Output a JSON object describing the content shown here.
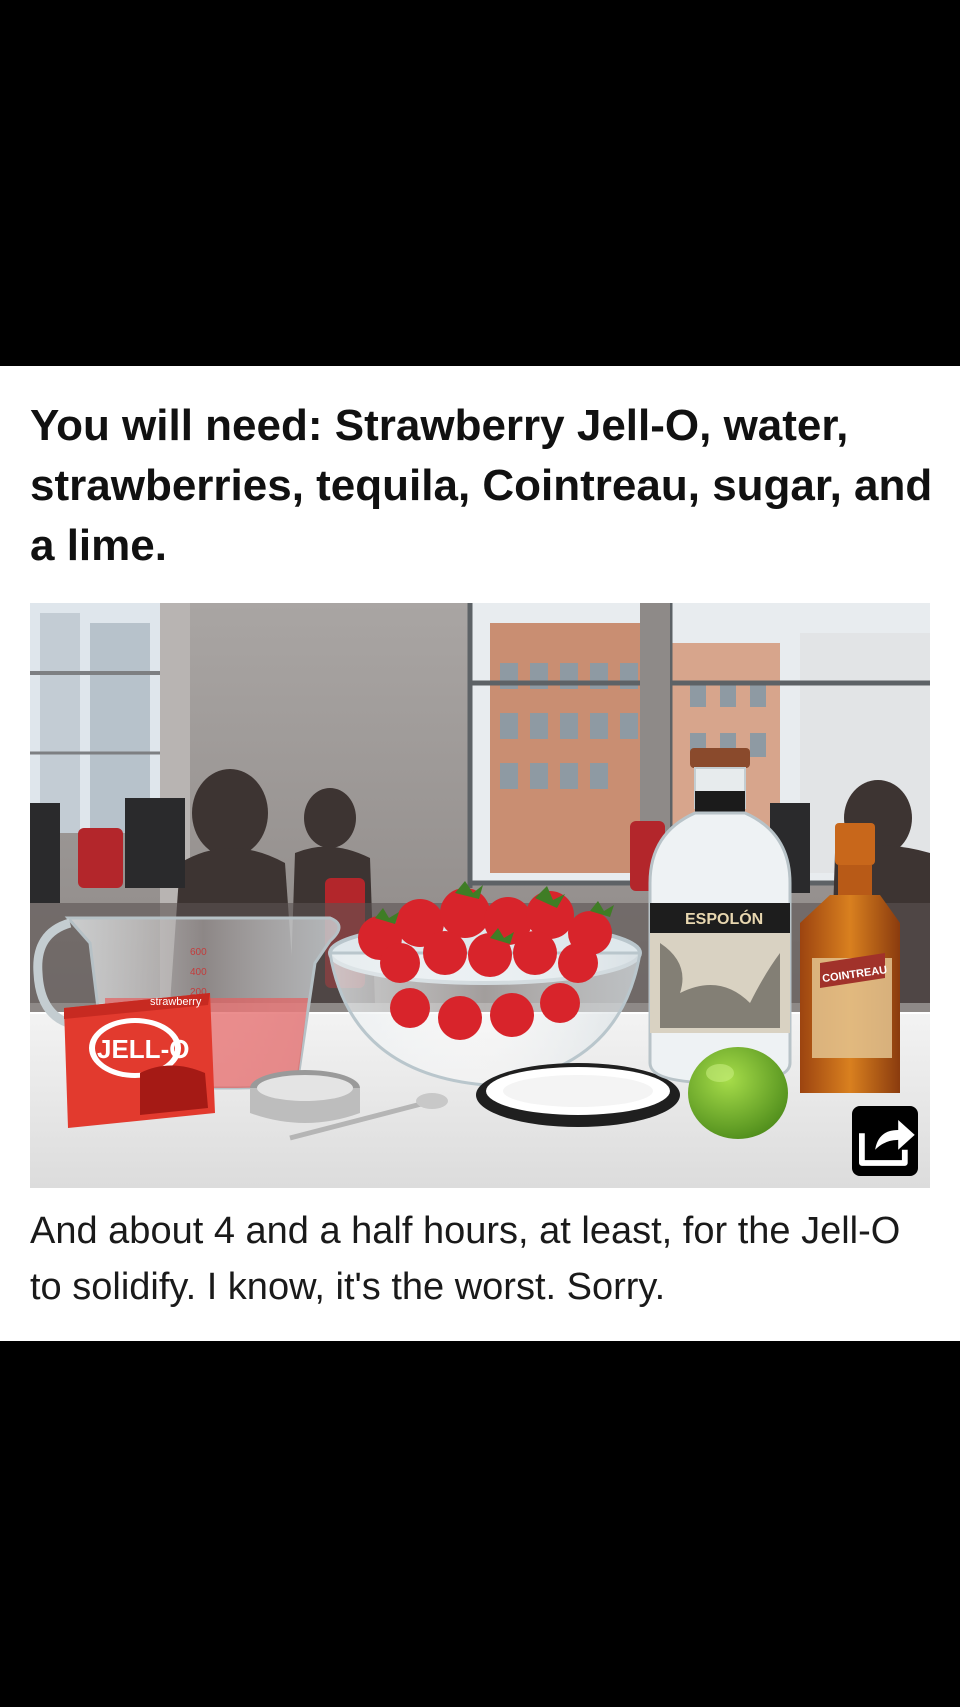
{
  "slide": {
    "heading": "You will need: Strawberry Jell-O, water, strawberries, tequila, Cointreau, sugar, and a lime.",
    "caption": "And about 4 and a half hours, at least, for the Jell-O to solidify. I know, it's the worst. Sorry.",
    "photo": {
      "label_jello_brand": "JELL-O",
      "label_jello_flavor": "strawberry",
      "label_tequila_brand": "ESPOLÓN",
      "label_liqueur_brand": "COINTREAU"
    },
    "share_icon": "share-icon"
  },
  "colors": {
    "page_background": "#000000",
    "card_background": "#ffffff",
    "text": "#111111",
    "jello_box": "#e23a2e",
    "strawberry": "#d8242b",
    "lime": "#6fb52c",
    "cointreau": "#c8671b"
  }
}
